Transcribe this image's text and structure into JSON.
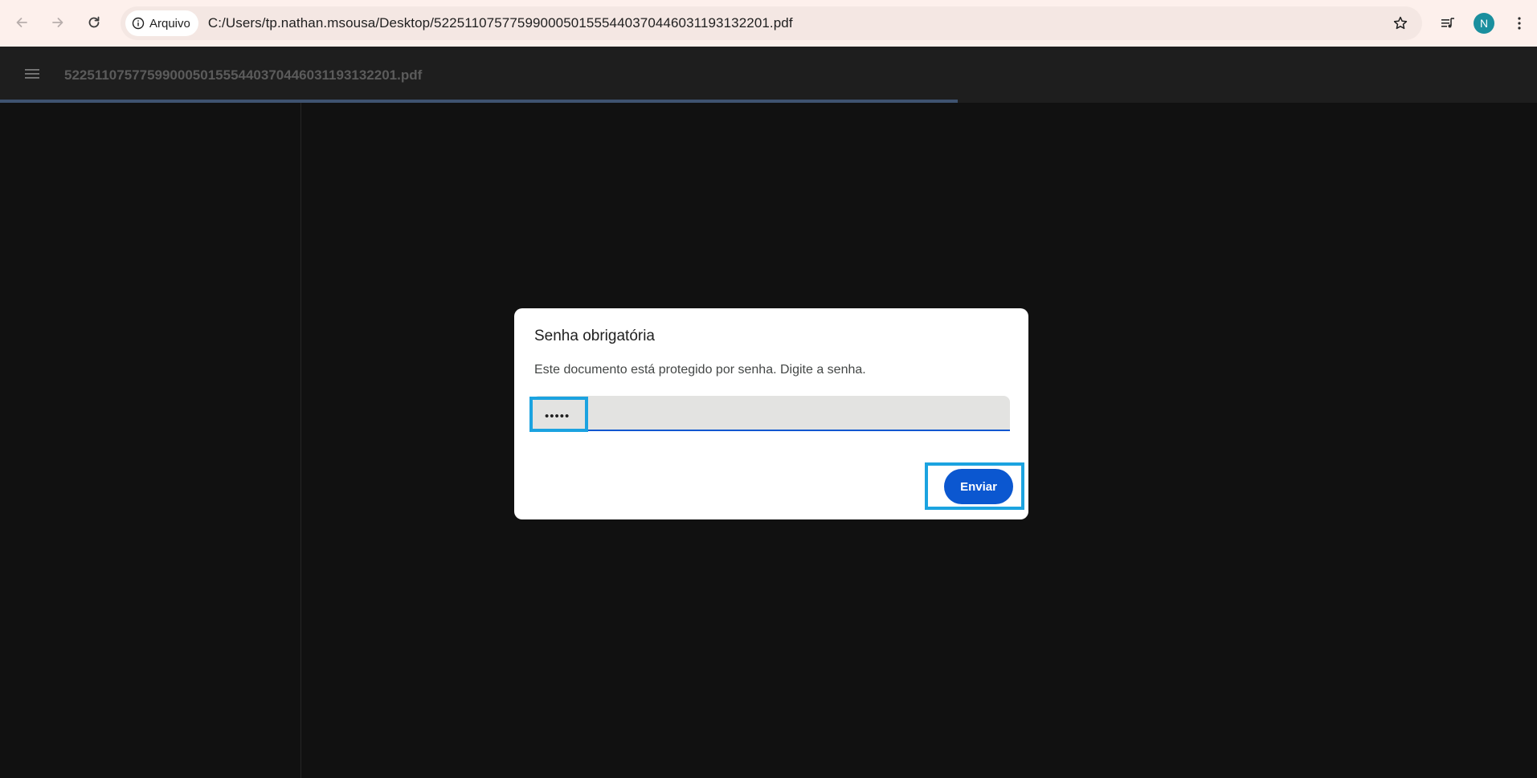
{
  "browser": {
    "back_icon": "arrow-left-icon",
    "forward_icon": "arrow-right-icon",
    "reload_icon": "reload-icon",
    "site_chip": {
      "icon": "info-icon",
      "label": "Arquivo"
    },
    "url": "C:/Users/tp.nathan.msousa/Desktop/52251107577599000501555440370446031193132201.pdf",
    "bookmark_icon": "star-outline-icon",
    "reading_list_icon": "media-list-icon",
    "profile_initial": "N",
    "menu_icon": "three-dots-vertical-icon"
  },
  "viewer": {
    "menu_icon": "hamburger-menu-icon",
    "title": "52251107577599000501555440370446031193132201.pdf",
    "progress": 0.623
  },
  "dialog": {
    "title": "Senha obrigatória",
    "message": "Este documento está protegido por senha. Digite a senha.",
    "password_value": "•••••",
    "submit_label": "Enviar"
  },
  "colors": {
    "accent": "#0b57d0",
    "highlight": "#1ba3e0",
    "viewer_background": "#111111",
    "toolbar": "#1e1e1e",
    "avatar": "#1a8f9e"
  }
}
